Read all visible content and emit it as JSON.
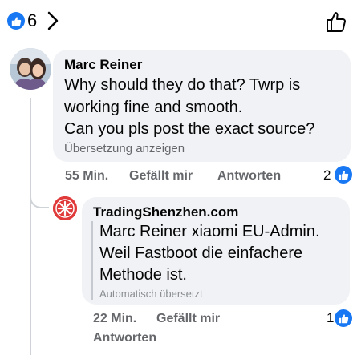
{
  "top_bar": {
    "like_count": "6",
    "icons": {
      "reaction": "like-icon",
      "expand": "chevron-right-icon",
      "action": "thumbs-up-outline-icon"
    }
  },
  "comment": {
    "author": "Marc Reiner",
    "lines": [
      "Why should they do that? Twrp is",
      "working fine and smooth.",
      "Can you pls post the exact source?"
    ],
    "translate_link": "Übersetzung anzeigen",
    "time": "55 Min.",
    "like_link": "Gefällt mir",
    "reply_link": "Antworten",
    "reaction_count": "2"
  },
  "reply": {
    "author": "TradingShenzhen.com",
    "lines": [
      "Marc Reiner xiaomi EU-Admin.",
      "Weil Fastboot die einfachere",
      "Methode ist."
    ],
    "translate_note": "Automatisch übersetzt",
    "time": "22 Min.",
    "like_link": "Gefällt mir",
    "reply_link": "Antworten",
    "reaction_count": "1"
  },
  "colors": {
    "accent": "#1877f2",
    "bubble": "#f0f2f5",
    "meta": "#65676b",
    "logo": "#e03a3a"
  }
}
